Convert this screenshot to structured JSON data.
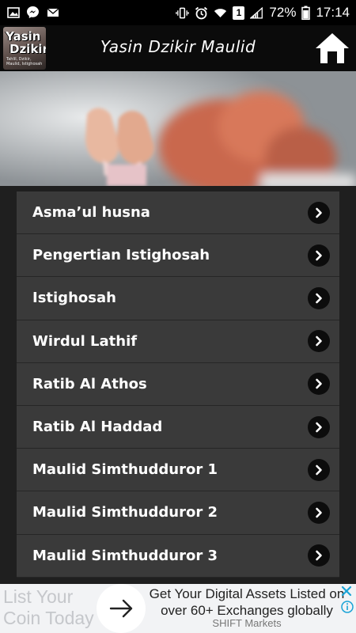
{
  "status_bar": {
    "battery_percent": "72%",
    "time": "17:14",
    "sim_badge": "1",
    "left_icons": [
      "image-icon",
      "messenger-icon",
      "mail-icon"
    ],
    "right_icons": [
      "vibrate-icon",
      "alarm-icon",
      "wifi-icon",
      "sim-icon",
      "signal-icon",
      "battery-icon"
    ]
  },
  "app_bar": {
    "title": "Yasin Dzikir Maulid",
    "logo_line1": "Yasin",
    "logo_line2": "Dzikir",
    "logo_small": "Tahlil, Dzikir, Maulid, Istighosah",
    "home_icon": "home-icon"
  },
  "menu": {
    "items": [
      {
        "label": "Asma’ul husna"
      },
      {
        "label": "Pengertian Istighosah"
      },
      {
        "label": "Istighosah"
      },
      {
        "label": "Wirdul Lathif"
      },
      {
        "label": "Ratib Al Athos"
      },
      {
        "label": "Ratib Al Haddad"
      },
      {
        "label": "Maulid Simthudduror 1"
      },
      {
        "label": "Maulid Simthudduror 2"
      },
      {
        "label": "Maulid Simthudduror 3"
      }
    ],
    "chevron_icon": "chevron-right-icon"
  },
  "ad": {
    "left_text_line1": "List Your",
    "left_text_line2": "Coin Today",
    "headline": "Get Your Digital Assets Listed on over 60+ Exchanges globally",
    "advertiser": "SHIFT Markets",
    "colors": {
      "background": "#f2f3f5",
      "headline": "#222222"
    }
  }
}
